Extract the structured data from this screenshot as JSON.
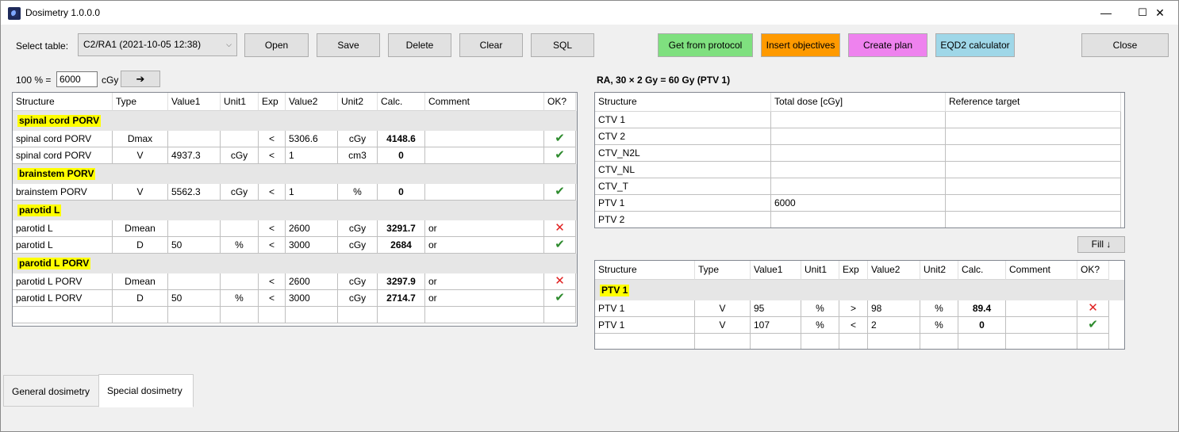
{
  "window": {
    "title": "Dosimetry 1.0.0.0",
    "minimize": "—",
    "maximize": "☐",
    "close": "✕"
  },
  "toolbar": {
    "select_label": "Select table:",
    "select_value": "C2/RA1 (2021-10-05 12:38)",
    "open": "Open",
    "save": "Save",
    "delete": "Delete",
    "clear": "Clear",
    "sql": "SQL",
    "get_from_protocol": "Get from protocol",
    "insert_objectives": "Insert objectives",
    "create_plan": "Create plan",
    "eqd2": "EQD2 calculator",
    "close": "Close",
    "colors": {
      "green": "#7fe07f",
      "orange": "#ff9a00",
      "pink": "#ee82ee",
      "blue": "#9fd7e8"
    }
  },
  "reference": {
    "prefix": "100 % =",
    "value": "6000",
    "unit": "cGy",
    "apply": "➔"
  },
  "left_grid": {
    "headers": [
      "Structure",
      "Type",
      "Value1",
      "Unit1",
      "Exp",
      "Value2",
      "Unit2",
      "Calc.",
      "Comment",
      "OK?"
    ],
    "groups": [
      {
        "name": "spinal cord PORV",
        "rows": [
          [
            "spinal cord PORV",
            "Dmax",
            "",
            "",
            "<",
            "5306.6",
            "cGy",
            "4148.6",
            "",
            "ok"
          ],
          [
            "spinal cord PORV",
            "V",
            "4937.3",
            "cGy",
            "<",
            "1",
            "cm3",
            "0",
            "",
            "ok"
          ]
        ]
      },
      {
        "name": "brainstem PORV",
        "rows": [
          [
            "brainstem PORV",
            "V",
            "5562.3",
            "cGy",
            "<",
            "1",
            "%",
            "0",
            "",
            "ok"
          ]
        ]
      },
      {
        "name": "parotid L",
        "rows": [
          [
            "parotid L",
            "Dmean",
            "",
            "",
            "<",
            "2600",
            "cGy",
            "3291.7",
            "or",
            "bad"
          ],
          [
            "parotid L",
            "D",
            "50",
            "%",
            "<",
            "3000",
            "cGy",
            "2684",
            "or",
            "ok"
          ]
        ]
      },
      {
        "name": "parotid L PORV",
        "rows": [
          [
            "parotid L PORV",
            "Dmean",
            "",
            "",
            "<",
            "2600",
            "cGy",
            "3297.9",
            "or",
            "bad"
          ],
          [
            "parotid L PORV",
            "D",
            "50",
            "%",
            "<",
            "3000",
            "cGy",
            "2714.7",
            "or",
            "ok"
          ]
        ]
      }
    ]
  },
  "prescription_title": "RA, 30 × 2 Gy = 60 Gy (PTV 1)",
  "targets_grid": {
    "headers": [
      "Structure",
      "Total dose [cGy]",
      "Reference target"
    ],
    "rows": [
      [
        "CTV 1",
        "",
        ""
      ],
      [
        "CTV 2",
        "",
        ""
      ],
      [
        "CTV_N2L",
        "",
        ""
      ],
      [
        "CTV_NL",
        "",
        ""
      ],
      [
        "CTV_T",
        "",
        ""
      ],
      [
        "PTV 1",
        "6000",
        ""
      ],
      [
        "PTV 2",
        "",
        ""
      ]
    ]
  },
  "fill_button": "Fill ↓",
  "right_grid": {
    "headers": [
      "Structure",
      "Type",
      "Value1",
      "Unit1",
      "Exp",
      "Value2",
      "Unit2",
      "Calc.",
      "Comment",
      "OK?"
    ],
    "group": "PTV 1",
    "rows": [
      [
        "PTV 1",
        "V",
        "95",
        "%",
        ">",
        "98",
        "%",
        "89.4",
        "",
        "bad"
      ],
      [
        "PTV 1",
        "V",
        "107",
        "%",
        "<",
        "2",
        "%",
        "0",
        "",
        "ok"
      ]
    ]
  },
  "tabs": [
    "General dosimetry",
    "Special dosimetry"
  ],
  "status_icons": {
    "ok": "✔",
    "bad": "✕"
  }
}
